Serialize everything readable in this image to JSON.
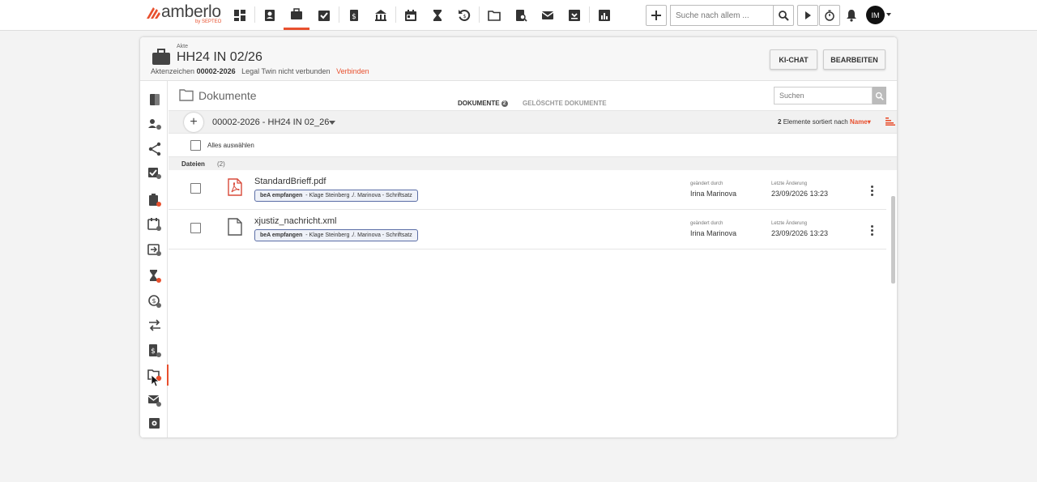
{
  "app": {
    "logo_text": "amberlo",
    "logo_sub": "by SEPTEO",
    "brand_color": "#e8502e"
  },
  "topbar": {
    "nav_icons": [
      "dashboard-icon",
      "contacts-icon",
      "matters-icon",
      "tasks-icon",
      "invoice-icon",
      "bank-icon",
      "calendar-icon",
      "hourglass-icon",
      "history-icon",
      "folder-icon",
      "document-search-icon",
      "mail-icon",
      "inbox-icon",
      "reports-icon"
    ],
    "search_placeholder": "Suche nach allem ...",
    "avatar_initials": "IM"
  },
  "akte": {
    "label": "Akte",
    "title": "HH24 IN 02/26",
    "aktenzeichen_label": "Aktenzeichen",
    "aktenzeichen": "00002-2026",
    "legal_twin_status": "Legal Twin nicht verbunden",
    "connect_link": "Verbinden",
    "ki_chat_button": "KI-CHAT",
    "edit_button": "BEARBEITEN"
  },
  "documents": {
    "title": "Dokumente",
    "tabs": [
      {
        "label": "DOKUMENTE",
        "badge": "2",
        "active": true
      },
      {
        "label": "GELÖSCHTE DOKUMENTE",
        "active": false
      }
    ],
    "search_placeholder": "Suchen",
    "path": "00002-2026 - HH24 IN 02_26",
    "count": "2",
    "sort_text": "Elemente sortiert nach",
    "sort_field": "Name",
    "select_all_label": "Alles auswählen",
    "group_label": "Dateien",
    "group_count": "(2)",
    "changed_by_label": "geändert durch",
    "last_change_label": "Letzte Änderung",
    "files": [
      {
        "name": "StandardBrieff.pdf",
        "icon": "pdf-icon",
        "tag_bold": "beA empfangen",
        "tag_text": "Klage Steinberg ./. Marinova - Schriftsatz",
        "changed_by": "Irina Marinova",
        "last_change": "23/09/2026 13:23"
      },
      {
        "name": "xjustiz_nachricht.xml",
        "icon": "file-icon",
        "tag_bold": "beA empfangen",
        "tag_text": "Klage Steinberg ./. Marinova - Schriftsatz",
        "changed_by": "Irina Marinova",
        "last_change": "23/09/2026 13:23"
      }
    ]
  }
}
